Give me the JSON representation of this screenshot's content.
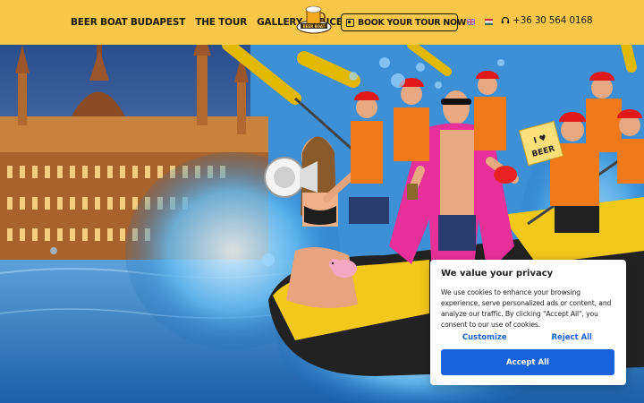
{
  "nav": {
    "items": [
      {
        "label": "BEER BOAT BUDAPEST"
      },
      {
        "label": "THE TOUR"
      },
      {
        "label": "GALLERY"
      },
      {
        "label": "PRICES"
      }
    ],
    "logo_icon": "beer-boat-logo",
    "book_button": {
      "label": "BOOK YOUR TOUR NOW!",
      "icon": "calendar-icon"
    },
    "languages": [
      {
        "name": "English",
        "icon": "uk-flag-icon"
      },
      {
        "name": "Hungarian",
        "icon": "hu-flag-icon"
      }
    ],
    "phone": {
      "number": "+36 30 564 0168",
      "icon": "headset-icon"
    }
  },
  "hero": {
    "sign_text": "I ♥ BEER"
  },
  "cookie": {
    "title": "We value your privacy",
    "body": "We use cookies to enhance your browsing experience, serve personalized ads or content, and analyze our traffic. By clicking \"Accept All\", you consent to our use of cookies.",
    "customize_label": "Customize",
    "reject_label": "Reject All",
    "accept_label": "Accept All"
  },
  "colors": {
    "header_bg": "#f9c84b",
    "nav_text": "#1e1a10",
    "accept_bg": "#1863dc",
    "link_blue": "#1863dc"
  }
}
